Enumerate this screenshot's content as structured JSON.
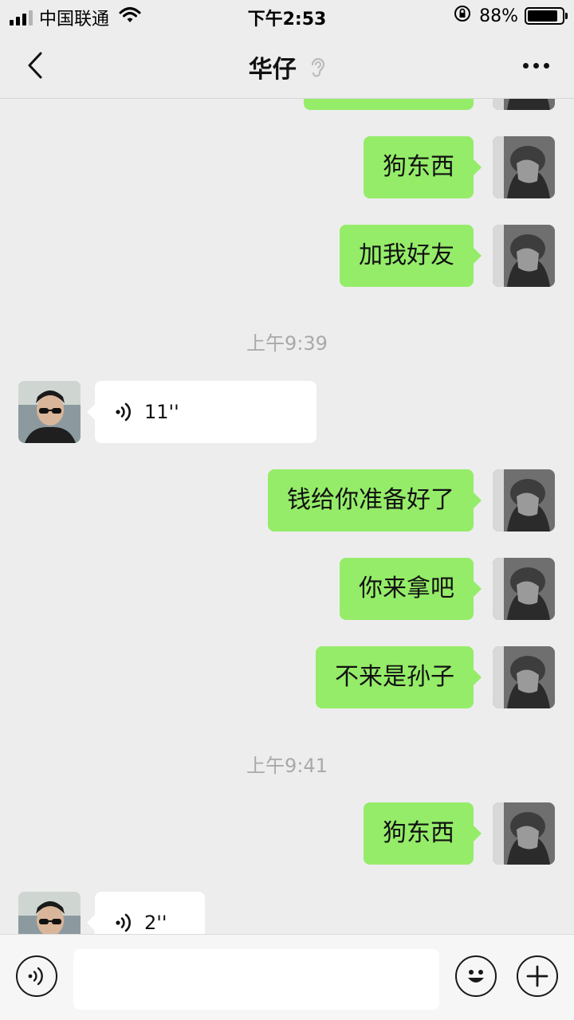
{
  "status_bar": {
    "carrier": "中国联通",
    "time": "下午2:53",
    "battery": "88%",
    "battery_level": 0.88,
    "icons": [
      "signal-icon",
      "wifi-icon",
      "orientation-lock-icon",
      "battery-icon"
    ]
  },
  "nav": {
    "title": "华仔",
    "icons": [
      "back-icon",
      "ear-icon",
      "more-icon"
    ]
  },
  "messages": [
    {
      "type": "text",
      "from": "me",
      "text": ""
    },
    {
      "type": "text",
      "from": "me",
      "text": "狗东西"
    },
    {
      "type": "text",
      "from": "me",
      "text": "加我好友"
    },
    {
      "type": "time",
      "text": "上午9:39"
    },
    {
      "type": "voice",
      "from": "other",
      "duration": "11''"
    },
    {
      "type": "text",
      "from": "me",
      "text": "钱给你准备好了"
    },
    {
      "type": "text",
      "from": "me",
      "text": "你来拿吧"
    },
    {
      "type": "text",
      "from": "me",
      "text": "不来是孙子"
    },
    {
      "type": "time",
      "text": "上午9:41"
    },
    {
      "type": "text",
      "from": "me",
      "text": "狗东西"
    },
    {
      "type": "voice",
      "from": "other",
      "duration": "2''"
    }
  ],
  "toolbar": {
    "input_value": "",
    "icons": [
      "voice-input-icon",
      "emoji-icon",
      "add-icon"
    ]
  },
  "colors": {
    "background": "#ededed",
    "my_bubble": "#95ec69",
    "other_bubble": "#ffffff",
    "timestamp": "#a9a9a9"
  }
}
